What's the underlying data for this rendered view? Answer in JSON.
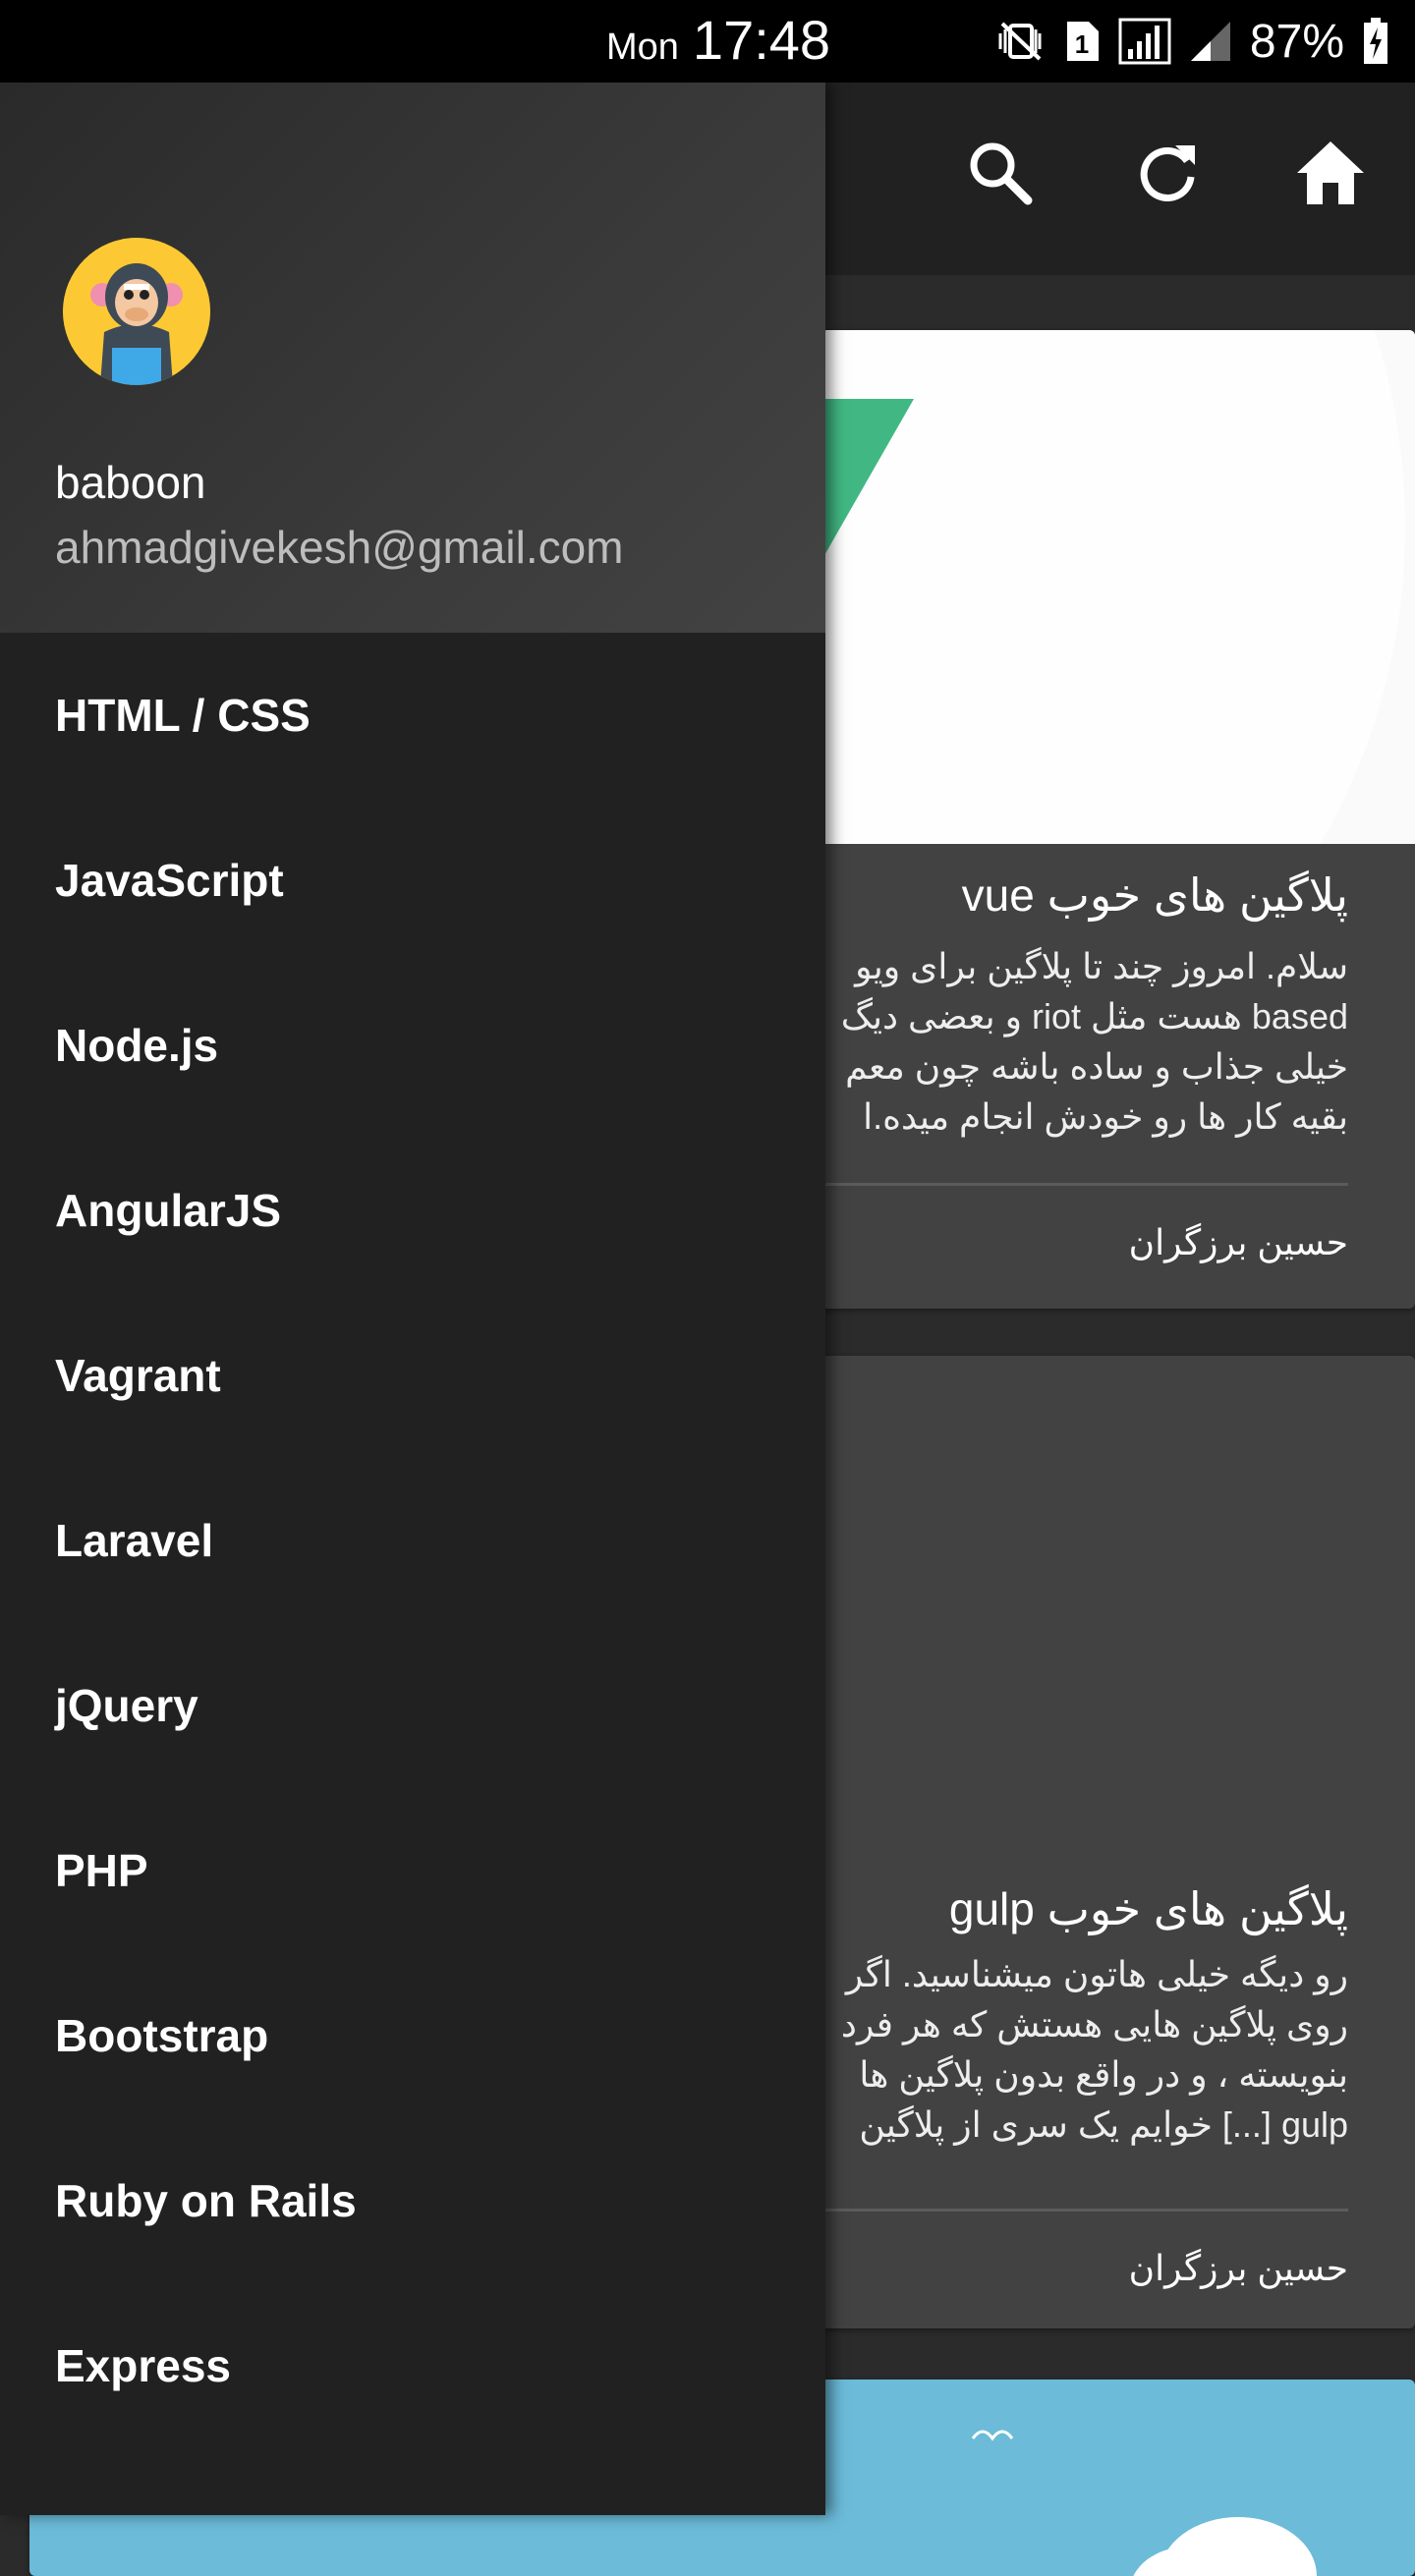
{
  "status_bar": {
    "day": "Mon",
    "time": "17:48",
    "battery": "87%",
    "icons": [
      "mute-vibrate-icon",
      "sim-1-icon",
      "signal-icon",
      "signal-weak-icon",
      "battery-charging-icon"
    ]
  },
  "app_bar": {
    "actions": [
      "search-icon",
      "refresh-icon",
      "home-icon"
    ]
  },
  "drawer": {
    "user": {
      "name": "baboon",
      "email": "ahmadgivekesh@gmail.com"
    },
    "items": [
      {
        "label": "HTML / CSS"
      },
      {
        "label": "JavaScript"
      },
      {
        "label": "Node.js"
      },
      {
        "label": "AngularJS"
      },
      {
        "label": "Vagrant"
      },
      {
        "label": "Laravel"
      },
      {
        "label": "jQuery"
      },
      {
        "label": "PHP"
      },
      {
        "label": "Bootstrap"
      },
      {
        "label": "Ruby on Rails"
      },
      {
        "label": "Express"
      }
    ]
  },
  "posts": [
    {
      "title": "پلاگین های خوب vue",
      "excerpt": [
        "سلام. امروز چند تا پلاگین برای ویو",
        "based هست مثل riot و بعضی دیگ",
        "خیلی جذاب و ساده باشه چون معم",
        "بقیه کار ها رو خودش انجام میده.ا"
      ],
      "author": "حسین برزگران"
    },
    {
      "title": "پلاگین های خوب gulp",
      "excerpt": [
        "رو دیگه خیلی هاتون میشناسید. اگر",
        "روی پلاگین هایی هستش که هر فرد",
        "بنویسته ، و در واقع بدون پلاگین ها",
        "gulp [...] خوایم یک سری از پلاگین"
      ],
      "author": "حسین برزگران"
    }
  ],
  "colors": {
    "status_bar": "#000000",
    "app_bar": "#212121",
    "drawer_bg": "#212121",
    "card_bg": "#424242",
    "vue_green": "#41b883",
    "avatar_bg": "#fcc934"
  }
}
